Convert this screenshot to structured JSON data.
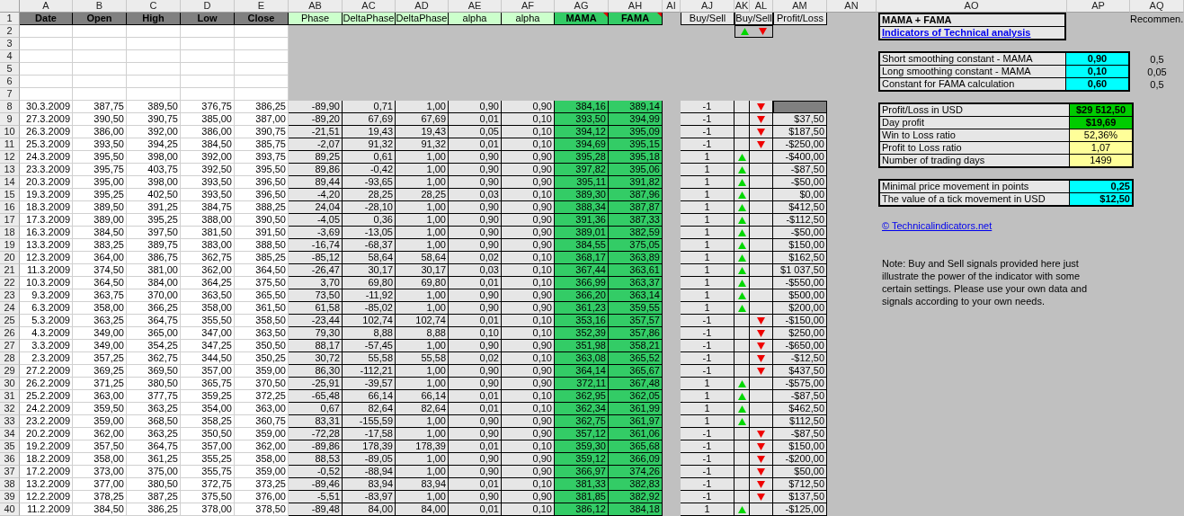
{
  "column_headers": [
    "A",
    "B",
    "C",
    "D",
    "E",
    "AB",
    "AC",
    "AD",
    "AE",
    "AF",
    "AG",
    "AH",
    "AI",
    "AJ",
    "AK",
    "AL",
    "AM",
    "AN",
    "AO",
    "AP",
    "AQ"
  ],
  "row_numbers": [
    "1",
    "2",
    "3",
    "4",
    "5",
    "6",
    "7",
    "8",
    "9",
    "10",
    "11",
    "12",
    "13",
    "14",
    "15",
    "16",
    "17",
    "18",
    "19",
    "20",
    "21",
    "22",
    "23",
    "24",
    "25",
    "26",
    "27",
    "28",
    "29",
    "30",
    "31",
    "32",
    "33",
    "34",
    "35",
    "36",
    "37",
    "38",
    "39",
    "40"
  ],
  "header": {
    "prices": [
      "Date",
      "Open",
      "High",
      "Low",
      "Close"
    ],
    "calc": [
      "Phase",
      "DeltaPhase",
      "DeltaPhase",
      "alpha",
      "alpha"
    ],
    "averages": [
      {
        "label": "MAMA",
        "comment": true
      },
      {
        "label": "FAMA",
        "comment": true
      }
    ],
    "signal": "Buy/Sell",
    "arrows": "Buy/Sell",
    "profit": "Profit/Loss"
  },
  "rows": [
    {
      "cells": [
        "30.3.2009",
        "387,75",
        "389,50",
        "376,75",
        "386,25",
        "-89,90",
        "0,71",
        "1,00",
        "0,90",
        "0,90",
        "384,16",
        "389,14"
      ],
      "signal": "-1",
      "kind": "sell"
    },
    {
      "cells": [
        "27.3.2009",
        "390,50",
        "390,75",
        "385,00",
        "387,00",
        "-89,20",
        "67,69",
        "67,69",
        "0,01",
        "0,10",
        "393,50",
        "394,99"
      ],
      "signal": "-1",
      "kind": "sell",
      "profit": "$37,50"
    },
    {
      "cells": [
        "26.3.2009",
        "386,00",
        "392,00",
        "386,00",
        "390,75",
        "-21,51",
        "19,43",
        "19,43",
        "0,05",
        "0,10",
        "394,12",
        "395,09"
      ],
      "signal": "-1",
      "kind": "sell",
      "profit": "$187,50"
    },
    {
      "cells": [
        "25.3.2009",
        "393,50",
        "394,25",
        "384,50",
        "385,75",
        "-2,07",
        "91,32",
        "91,32",
        "0,01",
        "0,10",
        "394,69",
        "395,15"
      ],
      "signal": "-1",
      "kind": "sell",
      "profit": "-$250,00"
    },
    {
      "cells": [
        "24.3.2009",
        "395,50",
        "398,00",
        "392,00",
        "393,75",
        "89,25",
        "0,61",
        "1,00",
        "0,90",
        "0,90",
        "395,28",
        "395,18"
      ],
      "signal": "1",
      "kind": "buy",
      "profit": "-$400,00"
    },
    {
      "cells": [
        "23.3.2009",
        "395,75",
        "403,75",
        "392,50",
        "395,50",
        "89,86",
        "-0,42",
        "1,00",
        "0,90",
        "0,90",
        "397,82",
        "395,06"
      ],
      "signal": "1",
      "kind": "buy",
      "profit": "-$87,50"
    },
    {
      "cells": [
        "20.3.2009",
        "395,00",
        "398,00",
        "393,50",
        "396,50",
        "89,44",
        "-93,65",
        "1,00",
        "0,90",
        "0,90",
        "395,11",
        "391,82"
      ],
      "signal": "1",
      "kind": "buy",
      "profit": "-$50,00"
    },
    {
      "cells": [
        "19.3.2009",
        "395,25",
        "402,50",
        "393,50",
        "396,50",
        "-4,20",
        "28,25",
        "28,25",
        "0,03",
        "0,10",
        "389,30",
        "387,96"
      ],
      "signal": "1",
      "kind": "buy",
      "profit": "$0,00"
    },
    {
      "cells": [
        "18.3.2009",
        "389,50",
        "391,25",
        "384,75",
        "388,25",
        "24,04",
        "-28,10",
        "1,00",
        "0,90",
        "0,90",
        "388,34",
        "387,87"
      ],
      "signal": "1",
      "kind": "buy",
      "profit": "$412,50"
    },
    {
      "cells": [
        "17.3.2009",
        "389,00",
        "395,25",
        "388,00",
        "390,50",
        "-4,05",
        "0,36",
        "1,00",
        "0,90",
        "0,90",
        "391,36",
        "387,33"
      ],
      "signal": "1",
      "kind": "buy",
      "profit": "-$112,50"
    },
    {
      "cells": [
        "16.3.2009",
        "384,50",
        "397,50",
        "381,50",
        "391,50",
        "-3,69",
        "-13,05",
        "1,00",
        "0,90",
        "0,90",
        "389,01",
        "382,59"
      ],
      "signal": "1",
      "kind": "buy",
      "profit": "-$50,00"
    },
    {
      "cells": [
        "13.3.2009",
        "383,25",
        "389,75",
        "383,00",
        "388,50",
        "-16,74",
        "-68,37",
        "1,00",
        "0,90",
        "0,90",
        "384,55",
        "375,05"
      ],
      "signal": "1",
      "kind": "buy",
      "profit": "$150,00"
    },
    {
      "cells": [
        "12.3.2009",
        "364,00",
        "386,75",
        "362,75",
        "385,25",
        "-85,12",
        "58,64",
        "58,64",
        "0,02",
        "0,10",
        "368,17",
        "363,89"
      ],
      "signal": "1",
      "kind": "buy",
      "profit": "$162,50"
    },
    {
      "cells": [
        "11.3.2009",
        "374,50",
        "381,00",
        "362,00",
        "364,50",
        "-26,47",
        "30,17",
        "30,17",
        "0,03",
        "0,10",
        "367,44",
        "363,61"
      ],
      "signal": "1",
      "kind": "buy",
      "profit": "$1 037,50"
    },
    {
      "cells": [
        "10.3.2009",
        "364,50",
        "384,00",
        "364,25",
        "375,50",
        "3,70",
        "69,80",
        "69,80",
        "0,01",
        "0,10",
        "366,99",
        "363,37"
      ],
      "signal": "1",
      "kind": "buy",
      "profit": "-$550,00"
    },
    {
      "cells": [
        "9.3.2009",
        "363,75",
        "370,00",
        "363,50",
        "365,50",
        "73,50",
        "-11,92",
        "1,00",
        "0,90",
        "0,90",
        "366,20",
        "363,14"
      ],
      "signal": "1",
      "kind": "buy",
      "profit": "$500,00"
    },
    {
      "cells": [
        "6.3.2009",
        "358,00",
        "366,25",
        "358,00",
        "361,50",
        "61,58",
        "-85,02",
        "1,00",
        "0,90",
        "0,90",
        "361,23",
        "359,55"
      ],
      "signal": "1",
      "kind": "buy",
      "profit": "$200,00"
    },
    {
      "cells": [
        "5.3.2009",
        "363,25",
        "364,75",
        "355,50",
        "358,50",
        "-23,44",
        "102,74",
        "102,74",
        "0,01",
        "0,10",
        "353,16",
        "357,57"
      ],
      "signal": "-1",
      "kind": "sell",
      "profit": "-$150,00"
    },
    {
      "cells": [
        "4.3.2009",
        "349,00",
        "365,00",
        "347,00",
        "363,50",
        "79,30",
        "8,88",
        "8,88",
        "0,10",
        "0,10",
        "352,39",
        "357,86"
      ],
      "signal": "-1",
      "kind": "sell",
      "profit": "$250,00"
    },
    {
      "cells": [
        "3.3.2009",
        "349,00",
        "354,25",
        "347,25",
        "350,50",
        "88,17",
        "-57,45",
        "1,00",
        "0,90",
        "0,90",
        "351,98",
        "358,21"
      ],
      "signal": "-1",
      "kind": "sell",
      "profit": "-$650,00"
    },
    {
      "cells": [
        "2.3.2009",
        "357,25",
        "362,75",
        "344,50",
        "350,25",
        "30,72",
        "55,58",
        "55,58",
        "0,02",
        "0,10",
        "363,08",
        "365,52"
      ],
      "signal": "-1",
      "kind": "sell",
      "profit": "-$12,50"
    },
    {
      "cells": [
        "27.2.2009",
        "369,25",
        "369,50",
        "357,00",
        "359,00",
        "86,30",
        "-112,21",
        "1,00",
        "0,90",
        "0,90",
        "364,14",
        "365,67"
      ],
      "signal": "-1",
      "kind": "sell",
      "profit": "$437,50"
    },
    {
      "cells": [
        "26.2.2009",
        "371,25",
        "380,50",
        "365,75",
        "370,50",
        "-25,91",
        "-39,57",
        "1,00",
        "0,90",
        "0,90",
        "372,11",
        "367,48"
      ],
      "signal": "1",
      "kind": "buy",
      "profit": "-$575,00"
    },
    {
      "cells": [
        "25.2.2009",
        "363,00",
        "377,75",
        "359,25",
        "372,25",
        "-65,48",
        "66,14",
        "66,14",
        "0,01",
        "0,10",
        "362,95",
        "362,05"
      ],
      "signal": "1",
      "kind": "buy",
      "profit": "-$87,50"
    },
    {
      "cells": [
        "24.2.2009",
        "359,50",
        "363,25",
        "354,00",
        "363,00",
        "0,67",
        "82,64",
        "82,64",
        "0,01",
        "0,10",
        "362,34",
        "361,99"
      ],
      "signal": "1",
      "kind": "buy",
      "profit": "$462,50"
    },
    {
      "cells": [
        "23.2.2009",
        "359,00",
        "368,50",
        "358,25",
        "360,75",
        "83,31",
        "-155,59",
        "1,00",
        "0,90",
        "0,90",
        "362,75",
        "361,97"
      ],
      "signal": "1",
      "kind": "buy",
      "profit": "$112,50"
    },
    {
      "cells": [
        "20.2.2009",
        "362,00",
        "363,25",
        "350,50",
        "359,00",
        "-72,28",
        "-17,58",
        "1,00",
        "0,90",
        "0,90",
        "357,12",
        "361,06"
      ],
      "signal": "-1",
      "kind": "sell",
      "profit": "-$87,50"
    },
    {
      "cells": [
        "19.2.2009",
        "357,50",
        "364,75",
        "357,00",
        "362,00",
        "-89,86",
        "178,39",
        "178,39",
        "0,01",
        "0,10",
        "359,30",
        "365,68"
      ],
      "signal": "-1",
      "kind": "sell",
      "profit": "$150,00"
    },
    {
      "cells": [
        "18.2.2009",
        "358,00",
        "361,25",
        "355,25",
        "358,00",
        "88,53",
        "-89,05",
        "1,00",
        "0,90",
        "0,90",
        "359,12",
        "366,09"
      ],
      "signal": "-1",
      "kind": "sell",
      "profit": "-$200,00"
    },
    {
      "cells": [
        "17.2.2009",
        "373,00",
        "375,00",
        "355,75",
        "359,00",
        "-0,52",
        "-88,94",
        "1,00",
        "0,90",
        "0,90",
        "366,97",
        "374,26"
      ],
      "signal": "-1",
      "kind": "sell",
      "profit": "$50,00"
    },
    {
      "cells": [
        "13.2.2009",
        "377,00",
        "380,50",
        "372,75",
        "373,25",
        "-89,46",
        "83,94",
        "83,94",
        "0,01",
        "0,10",
        "381,33",
        "382,83"
      ],
      "signal": "-1",
      "kind": "sell",
      "profit": "$712,50"
    },
    {
      "cells": [
        "12.2.2009",
        "378,25",
        "387,25",
        "375,50",
        "376,00",
        "-5,51",
        "-83,97",
        "1,00",
        "0,90",
        "0,90",
        "381,85",
        "382,92"
      ],
      "signal": "-1",
      "kind": "sell",
      "profit": "$137,50"
    },
    {
      "cells": [
        "11.2.2009",
        "384,50",
        "386,25",
        "378,00",
        "378,50",
        "-89,48",
        "84,00",
        "84,00",
        "0,01",
        "0,10",
        "386,12",
        "384,18"
      ],
      "signal": "1",
      "kind": "buy",
      "profit": "-$125,00"
    }
  ],
  "panel": {
    "title": "MAMA + FAMA",
    "link": "Indicators of Technical analysis",
    "recommended_heading": "Recommen.",
    "parameters": [
      {
        "label": "Short smoothing constant - MAMA",
        "value": "0,90",
        "recommended": "0,5"
      },
      {
        "label": "Long smoothing constant - MAMA",
        "value": "0,10",
        "recommended": "0,05"
      },
      {
        "label": "Constant for FAMA calculation",
        "value": "0,60",
        "recommended": "0,5"
      }
    ],
    "results": [
      {
        "label": "Profit/Loss in USD",
        "value": "$29 512,50",
        "kind": "profit"
      },
      {
        "label": "Day profit",
        "value": "$19,69",
        "kind": "profit"
      },
      {
        "label": "Win to Loss ratio",
        "value": "52,36%",
        "kind": "ratio"
      },
      {
        "label": "Profit to Loss ratio",
        "value": "1,07",
        "kind": "ratio"
      },
      {
        "label": "Number of trading days",
        "value": "1499",
        "kind": "ratio"
      }
    ],
    "tick_settings": [
      {
        "label": "Minimal price movement in points",
        "value": "0,25"
      },
      {
        "label": "The value of a tick movement in USD",
        "value": "$12,50"
      }
    ],
    "site_link": "© Technicalindicators.net",
    "note": "Note: Buy and Sell signals provided here just illustrate the power of the indicator with some certain settings. Please use your own data and signals according to your own needs."
  }
}
